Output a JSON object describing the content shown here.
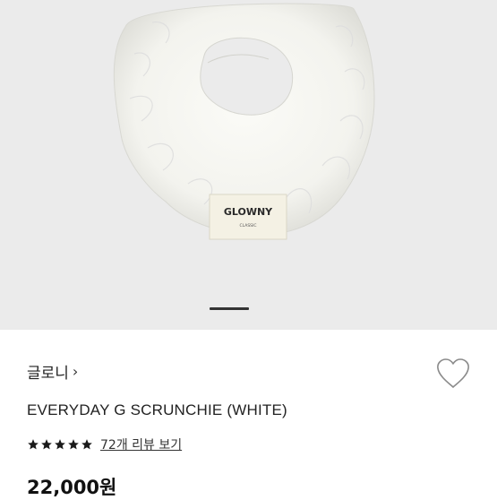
{
  "product": {
    "image": {
      "subject": "white-scrunchie",
      "tag_brand": "GLOWNY",
      "tag_sub": "CLASSIC",
      "background_color": "#ebebeb",
      "current_slide_indicator": "active"
    },
    "brand": {
      "name": "글로니",
      "chevron": "›"
    },
    "wishlist_icon": "heart-outline-icon",
    "title": "EVERYDAY G SCRUNCHIE (WHITE)",
    "rating": {
      "stars": 5,
      "max_stars": 5,
      "review_link": "72개 리뷰 보기"
    },
    "price": "22,000원"
  }
}
